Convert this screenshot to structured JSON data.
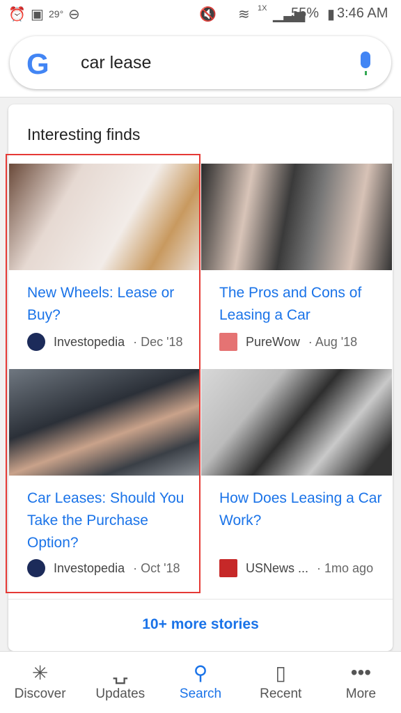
{
  "status": {
    "temp": "29°",
    "network": "1X",
    "battery": "55%",
    "time": "3:46 AM"
  },
  "search": {
    "logo": "G",
    "query": "car lease"
  },
  "card": {
    "title": "Interesting finds",
    "more": "10+ more stories",
    "items": [
      {
        "title": "New Wheels: Lease or Buy?",
        "source": "Investopedia",
        "date": "· Dec '18",
        "logo_color": "#1c2b5a"
      },
      {
        "title": "The Pros and Cons of Leasing a Car",
        "source": "PureWow",
        "date": "· Aug '18",
        "logo_color": "#e57373"
      },
      {
        "title": "Car Leases: Should You Take the Purchase Option?",
        "source": "Investopedia",
        "date": "· Oct '18",
        "logo_color": "#1c2b5a"
      },
      {
        "title": "How Does Leasing a Car Work?",
        "source": "USNews ...",
        "date": "· 1mo ago",
        "logo_color": "#c62828"
      }
    ]
  },
  "nav": [
    {
      "label": "Discover",
      "icon": "asterisk-icon"
    },
    {
      "label": "Updates",
      "icon": "inbox-icon"
    },
    {
      "label": "Search",
      "icon": "search-icon",
      "active": true
    },
    {
      "label": "Recent",
      "icon": "cards-icon"
    },
    {
      "label": "More",
      "icon": "more-icon"
    }
  ],
  "accent": "#1a73e8"
}
